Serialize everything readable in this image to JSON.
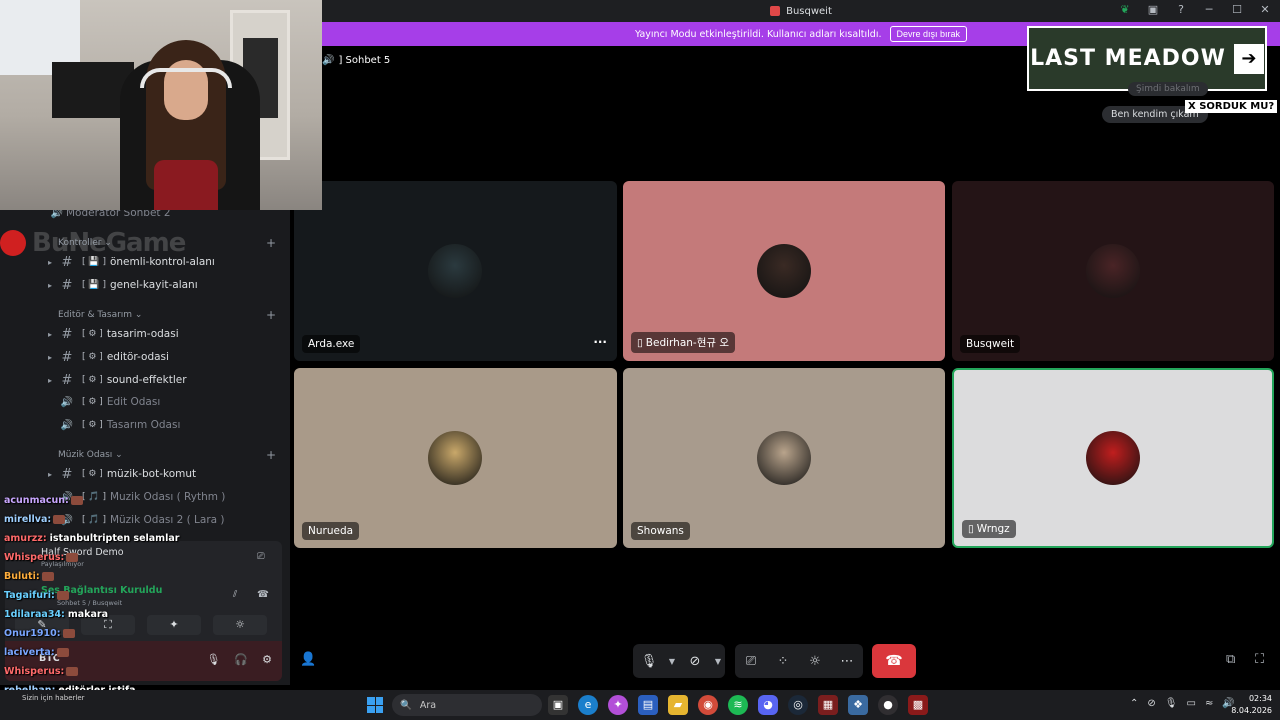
{
  "window": {
    "title": "Busqweit",
    "controls": [
      "─",
      "☐",
      "✕"
    ]
  },
  "banner": {
    "text": "Yayıncı Modu etkinleştirildi. Kullanıcı adları kısaltıldı.",
    "button": "Devre dışı bırak"
  },
  "call": {
    "channel": "] Sohbet 5"
  },
  "overlay": {
    "logo_text": "LAST MEADOW",
    "logo_arrow": "➔",
    "tag": "X SORDUK MU?",
    "chat_bubble": "Ben kendim çıkam",
    "chat_bubble_top": "Şimdi bakalım"
  },
  "watermark": "BuNeGame",
  "sidebar": {
    "top_item": "Moderatör Sohbet 2",
    "categories": [
      {
        "label": "Kontroller ⌄"
      },
      {
        "label": "Editör & Tasarım ⌄"
      },
      {
        "label": "Müzik Odası ⌄"
      }
    ],
    "channels": [
      {
        "label": "önemli-kontrol-alanı",
        "tag": "[ 💾 ]",
        "type": "text"
      },
      {
        "label": "genel-kayit-alanı",
        "tag": "[ 💾 ]",
        "type": "text"
      },
      {
        "label": "tasarim-odasi",
        "tag": "[ ⚙ ]",
        "type": "text"
      },
      {
        "label": "editör-odasi",
        "tag": "[ ⚙ ]",
        "type": "text"
      },
      {
        "label": "sound-effektler",
        "tag": "[ ⚙ ]",
        "type": "text"
      },
      {
        "label": "Edit Odası",
        "tag": "[ ⚙ ]",
        "type": "voice"
      },
      {
        "label": "Tasarım Odası",
        "tag": "[ ⚙ ]",
        "type": "voice"
      },
      {
        "label": "müzik-bot-komut",
        "tag": "[ ⚙ ]",
        "type": "text"
      },
      {
        "label": "Muzik Odası ( Rythm )",
        "tag": "[ 🎵 ]",
        "type": "voice"
      },
      {
        "label": "Müzik Odası 2 ( Lara )",
        "tag": "[ 🎵 ]",
        "type": "voice"
      }
    ]
  },
  "voice_panel": {
    "activity": "Half Sword Demo",
    "activity_sub": "Paylaşılmıyor",
    "status": "Ses Bağlantısı Kuruldu",
    "location": "Sohbet 5 / Busqweit",
    "user": "BTC",
    "btn_icons": [
      "✎",
      "⛶",
      "✦",
      "☼"
    ]
  },
  "chat": [
    {
      "user": "acunmacun:",
      "text": "",
      "color": "#c9a7ff"
    },
    {
      "user": "mirellva:",
      "text": "",
      "color": "#9fd0ff"
    },
    {
      "user": "amurzz:",
      "text": "istanbultripten selamlar",
      "color": "#ff6a6a"
    },
    {
      "user": "Whisperus:",
      "text": "",
      "color": "#ff6a6a"
    },
    {
      "user": "Buluti:",
      "text": "",
      "color": "#ffae3c"
    },
    {
      "user": "Tagaifuri:",
      "text": "",
      "color": "#6ad0ff"
    },
    {
      "user": "1dilaraa34:",
      "text": "makara",
      "color": "#6ad0ff"
    },
    {
      "user": "Onur1910:",
      "text": "",
      "color": "#7aa6ff"
    },
    {
      "user": "laciverta:",
      "text": "",
      "color": "#7aa6ff"
    },
    {
      "user": "Whisperus:",
      "text": "",
      "color": "#ff6a6a"
    },
    {
      "user": "rebelhan:",
      "text": "editörler istifa",
      "color": "#9fd0ff"
    },
    {
      "user": "Kaizer48:",
      "text": "",
      "color": "#9fd0ff"
    }
  ],
  "participants": [
    {
      "name": "Arda.exe",
      "bg": "#15191c",
      "avatar": "#2b3a3f",
      "phone": false,
      "more": "···"
    },
    {
      "name": "Bedirhan-현규 오",
      "bg": "#c47a7a",
      "avatar": "#3a2a24",
      "phone": true,
      "more": ""
    },
    {
      "name": "Busqweit",
      "bg": "#241416",
      "avatar": "#4a2426",
      "phone": false,
      "more": ""
    },
    {
      "name": "Nurueda",
      "bg": "#a99a89",
      "avatar": "#c9a86a",
      "phone": false,
      "more": ""
    },
    {
      "name": "Showans",
      "bg": "#a89b8d",
      "avatar": "#b9a48c",
      "phone": false,
      "more": ""
    },
    {
      "name": "Wrngz",
      "bg": "#dcdcdd",
      "avatar": "#c01e1e",
      "phone": true,
      "more": ""
    }
  ],
  "taskbar": {
    "search_placeholder": "Ara",
    "time": "02:34",
    "date": "8.04.2026",
    "news": "Sizin için haberler"
  }
}
